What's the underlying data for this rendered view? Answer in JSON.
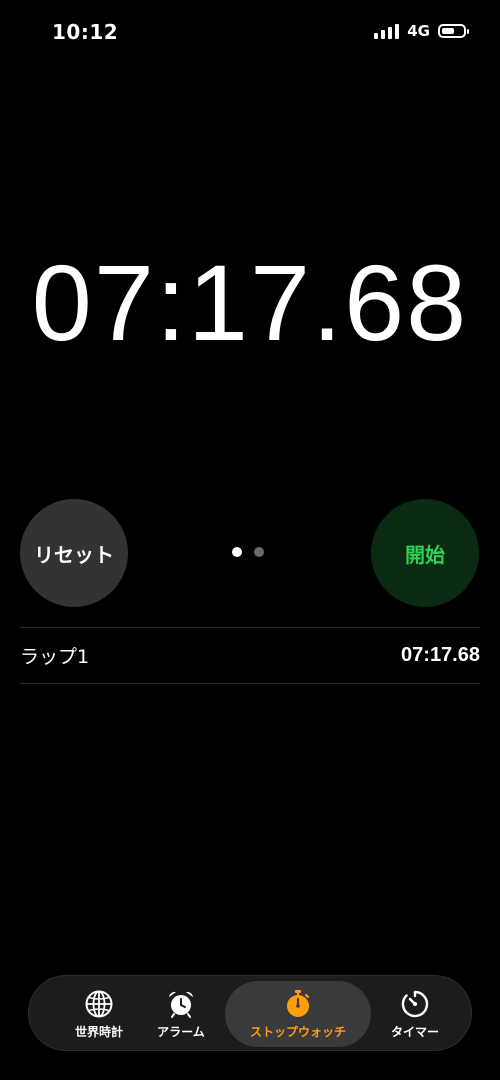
{
  "status_bar": {
    "time": "10:12",
    "network": "4G"
  },
  "stopwatch": {
    "elapsed": "07:17.68"
  },
  "controls": {
    "reset_label": "リセット",
    "start_label": "開始",
    "page_count": 2,
    "active_page": 1
  },
  "laps": [
    {
      "label": "ラップ1",
      "time": "07:17.68"
    }
  ],
  "tabs": [
    {
      "label": "世界時計",
      "icon": "globe-icon",
      "selected": false
    },
    {
      "label": "アラーム",
      "icon": "alarm-clock-icon",
      "selected": false
    },
    {
      "label": "ストップウォッチ",
      "icon": "stopwatch-icon",
      "selected": true
    },
    {
      "label": "タイマー",
      "icon": "timer-icon",
      "selected": false
    }
  ],
  "colors": {
    "background": "#000000",
    "start_text": "#30d158",
    "start_bg": "#0a2a12",
    "accent": "#ff9f0a",
    "reset_bg": "#333333"
  }
}
